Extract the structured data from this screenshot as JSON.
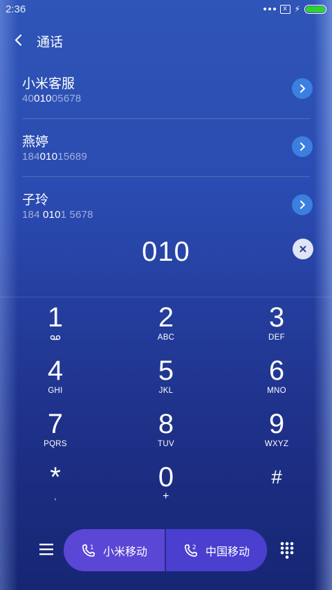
{
  "status_bar": {
    "time": "2:36",
    "sim_icon": "x",
    "battery_level": 1.0,
    "battery_color": "#2ed22e"
  },
  "header": {
    "title": "通话"
  },
  "contacts": [
    {
      "name": "小米客服",
      "number_pre": "40",
      "number_match": "010",
      "number_post": "05678"
    },
    {
      "name": "燕婷",
      "number_pre": "184",
      "number_match": "010",
      "number_post": "15689"
    },
    {
      "name": "子玲",
      "number_pre": "184 ",
      "number_match": "010",
      "number_post": "1 5678"
    }
  ],
  "dialed": {
    "number": "010"
  },
  "keypad": {
    "keys": [
      {
        "digit": "1",
        "sub": ""
      },
      {
        "digit": "2",
        "sub": "ABC"
      },
      {
        "digit": "3",
        "sub": "DEF"
      },
      {
        "digit": "4",
        "sub": "GHI"
      },
      {
        "digit": "5",
        "sub": "JKL"
      },
      {
        "digit": "6",
        "sub": "MNO"
      },
      {
        "digit": "7",
        "sub": "PQRS"
      },
      {
        "digit": "8",
        "sub": "TUV"
      },
      {
        "digit": "9",
        "sub": "WXYZ"
      },
      {
        "digit": "*",
        "sub": ","
      },
      {
        "digit": "0",
        "sub": "+"
      },
      {
        "digit": "#",
        "sub": ""
      }
    ]
  },
  "bottom_bar": {
    "sim1_label": "小米移动",
    "sim2_label": "中国移动",
    "sim1_index": "1",
    "sim2_index": "2"
  },
  "colors": {
    "accent_pill": "#5a47d6",
    "arrow_button": "#3b7fe0"
  }
}
